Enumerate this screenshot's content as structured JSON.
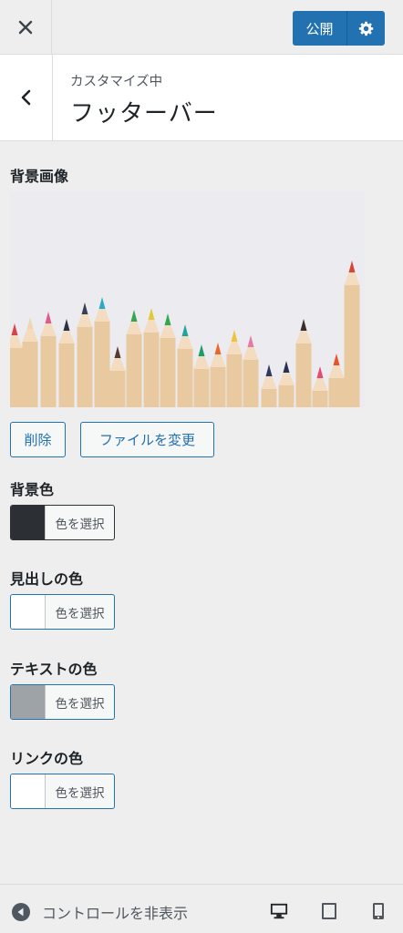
{
  "header": {
    "close_icon": "close-icon",
    "publish_label": "公開",
    "settings_icon": "gear-icon",
    "accent_color": "#2271b1"
  },
  "section": {
    "breadcrumb": "カスタマイズ中",
    "title": "フッターバー"
  },
  "background_image": {
    "label": "背景画像",
    "remove_label": "削除",
    "change_label": "ファイルを変更"
  },
  "colors": [
    {
      "label": "背景色",
      "button": "色を選択",
      "value": "#2c2f33"
    },
    {
      "label": "見出しの色",
      "button": "色を選択",
      "value": "#ffffff"
    },
    {
      "label": "テキストの色",
      "button": "色を選択",
      "value": "#9ea3a8"
    },
    {
      "label": "リンクの色",
      "button": "色を選択",
      "value": "#ffffff"
    }
  ],
  "footer": {
    "collapse_label": "コントロールを非表示",
    "devices": [
      "desktop-icon",
      "tablet-icon",
      "mobile-icon"
    ]
  }
}
